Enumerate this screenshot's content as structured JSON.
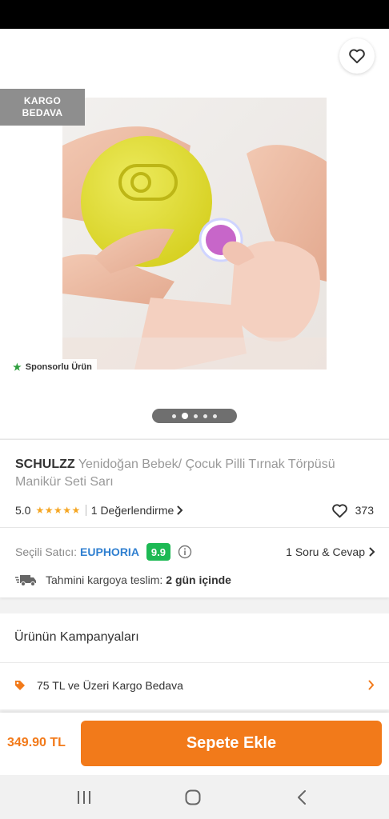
{
  "header": {
    "back_icon": "arrow-left-icon",
    "share_icon": "share-icon",
    "favorite_icon": "heart-outline-icon"
  },
  "badge": {
    "line1": "KARGO",
    "line2": "BEDAVA"
  },
  "sponsored": {
    "label": "Sponsorlu Ürün",
    "icon": "star-icon"
  },
  "gallery": {
    "slides": 5,
    "active_index": 1
  },
  "product": {
    "brand": "SCHULZZ",
    "name": " Yenidoğan Bebek/ Çocuk Pilli Tırnak Törpüsü Manikür Seti Sarı",
    "rating": "5.0",
    "stars": "★★★★★",
    "reviews_label": "1 Değerlendirme",
    "favorite_count": "373"
  },
  "seller": {
    "label": "Seçili Satıcı:",
    "name": "EUPHORIA",
    "score": "9.9",
    "qa_label": "1 Soru & Cevap",
    "delivery_label": "Tahmini kargoya teslim:",
    "delivery_value": "2 gün içinde"
  },
  "campaigns": {
    "title": "Ürünün Kampanyaları",
    "items": [
      {
        "label": "75 TL ve Üzeri Kargo Bedava",
        "icon": "tag-icon"
      }
    ]
  },
  "cart": {
    "price": "349.90 TL",
    "button_label": "Sepete Ekle"
  },
  "colors": {
    "accent": "#f27a1a",
    "seller_link": "#2f7fd0",
    "score_badge": "#1db954",
    "star": "#f5a623"
  },
  "system_nav": {
    "recent_icon": "recent-apps-icon",
    "home_icon": "home-icon",
    "back_icon": "back-chevron-icon"
  }
}
